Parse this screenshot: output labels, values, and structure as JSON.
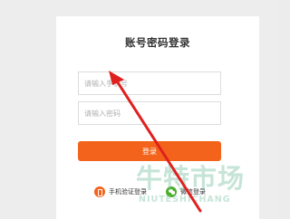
{
  "page": {
    "title": "账号密码登录"
  },
  "form": {
    "phone_placeholder": "请输入手机号",
    "password_placeholder": "请输入密码",
    "login_label": "登录"
  },
  "alt_logins": {
    "phone_label": "手机验证登录",
    "phone_icon": "mobile-phone-icon",
    "wechat_label": "微信登录",
    "wechat_icon": "wechat-icon"
  },
  "watermark": {
    "text_cn": "牛特市场",
    "text_en": "NIUTESHICHANG"
  },
  "colors": {
    "accent": "#f3631b",
    "arrow": "#e0201e",
    "wechat": "#4caf2a",
    "watermark": "#78bea0"
  }
}
